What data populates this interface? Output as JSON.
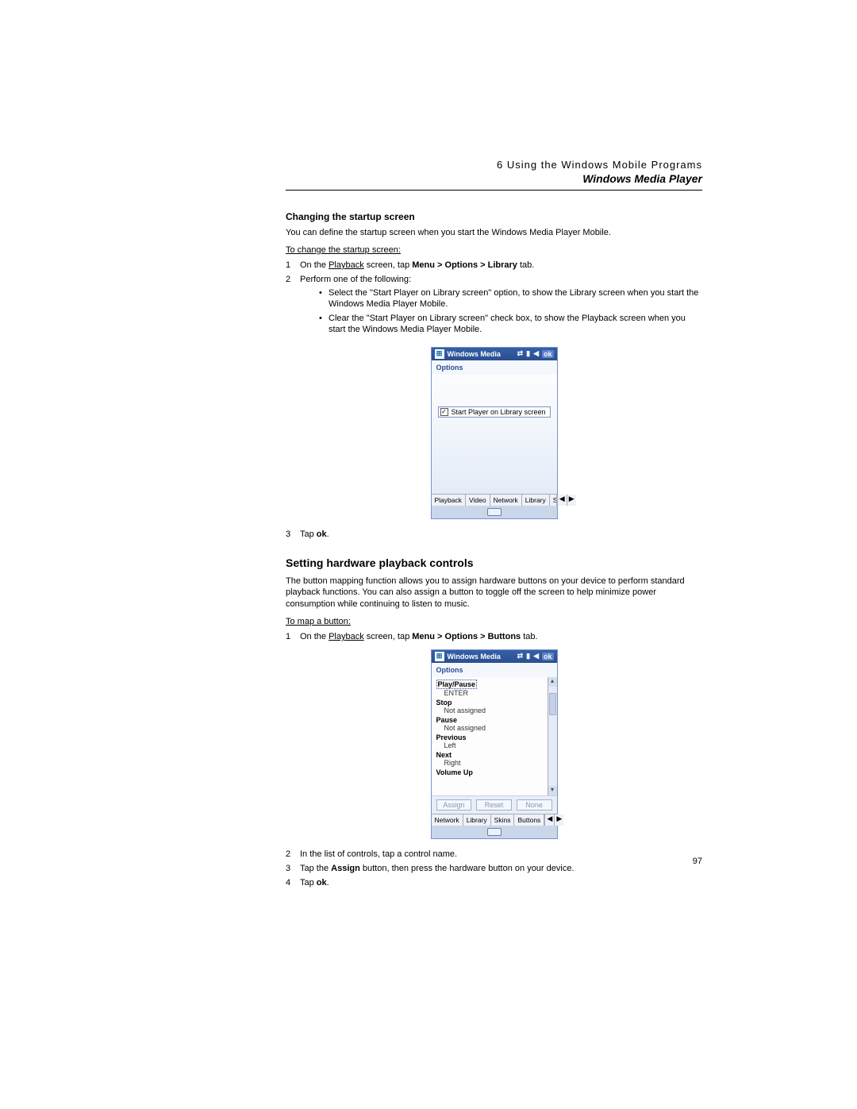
{
  "header": {
    "kicker_prefix": "6",
    "kicker": "Using the Windows Mobile Programs",
    "title": "Windows Media Player"
  },
  "section1": {
    "heading": "Changing the startup screen",
    "intro": "You can define the startup screen when you start the Windows Media Player Mobile.",
    "proc_title": "To change the startup screen:",
    "steps": {
      "1": {
        "pre": "On the ",
        "u": "Playback",
        "mid": " screen, tap ",
        "bold": "Menu > Options > Library",
        "post": " tab."
      },
      "2": "Perform one of the following:",
      "bullets": [
        "Select the \"Start Player on Library screen\" option, to show the Library screen when you start the Windows Media Player Mobile.",
        "Clear the \"Start Player on Library screen\" check box, to show the Playback screen when you start the Windows Media Player Mobile."
      ],
      "3": {
        "pre": "Tap ",
        "bold": "ok",
        "post": "."
      }
    }
  },
  "shot1": {
    "title": "Windows Media",
    "ok": "ok",
    "options": "Options",
    "checkbox_label": "Start Player on Library screen",
    "tabs": [
      "Playback",
      "Video",
      "Network",
      "Library",
      "Skins"
    ]
  },
  "section2": {
    "heading": "Setting hardware playback controls",
    "intro": "The button mapping function allows you to assign hardware buttons on your device to perform standard playback functions. You can also assign a button to toggle off the screen to help minimize power consumption while continuing to listen to music.",
    "proc_title": "To map a button:",
    "steps": {
      "1": {
        "pre": "On the ",
        "u": "Playback",
        "mid": " screen, tap ",
        "bold": "Menu > Options > Buttons",
        "post": " tab."
      },
      "2": "In the list of controls, tap a control name.",
      "3": {
        "pre": "Tap the ",
        "bold": "Assign",
        "post": " button, then press the hardware button on your device."
      },
      "4": {
        "pre": "Tap ",
        "bold": "ok",
        "post": "."
      }
    }
  },
  "shot2": {
    "title": "Windows Media",
    "ok": "ok",
    "options": "Options",
    "controls": [
      {
        "name": "Play/Pause",
        "value": "ENTER",
        "hl": true
      },
      {
        "name": "Stop",
        "value": "Not assigned"
      },
      {
        "name": "Pause",
        "value": "Not assigned"
      },
      {
        "name": "Previous",
        "value": "Left"
      },
      {
        "name": "Next",
        "value": "Right"
      },
      {
        "name": "Volume Up",
        "value": ""
      }
    ],
    "buttons": [
      "Assign",
      "Reset",
      "None"
    ],
    "tabs": [
      "Network",
      "Library",
      "Skins",
      "Buttons"
    ]
  },
  "page_number": "97"
}
